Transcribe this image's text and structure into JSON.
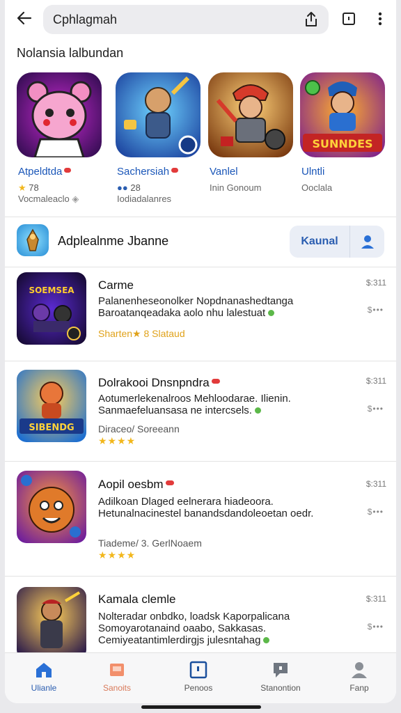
{
  "header": {
    "search_text": "Cphlagmah"
  },
  "section": {
    "title": "Nolansia lalbundan"
  },
  "featured": [
    {
      "name": "Atpeldtda",
      "rating": "78",
      "rating_icon": "star-icon",
      "developer": "Vocmaleaclo"
    },
    {
      "name": "Sachersiah",
      "rating": "28",
      "rating_icon": "dots-icon",
      "developer": "Iodiadalanres"
    },
    {
      "name": "Vanlel",
      "rating": "",
      "rating_icon": "",
      "developer": "Inin Gonoum"
    },
    {
      "name": "Ulntli",
      "rating": "",
      "rating_icon": "",
      "developer": "Ooclala"
    }
  ],
  "featured_banner_text": "SUNNDES",
  "install_row": {
    "name": "Adplealnme Jbanne",
    "button_label": "Kaunal"
  },
  "list": [
    {
      "title": "Carme",
      "description": "Palanenheseonolker Nopdnanashedtanga Baroatanqeadaka aolo nhu lalestuat",
      "meta": "Sharten★ 8 Slataud",
      "stars": "",
      "price": "$:311",
      "more": "$•••",
      "icon_text": "SOEMSEA"
    },
    {
      "title": "Dolrakooi Dnsnpndra",
      "description": "Aotumerlekenalroos Mehloodarae. Ilienin. Sanmaefeluansasa ne intercsels.",
      "meta": "Diraceo/ Soreeann",
      "stars": "★★★★",
      "price": "$:311",
      "more": "$•••",
      "icon_text": "SIBENDG"
    },
    {
      "title": "Aopil oesbm",
      "description": "Adilkoan Dlaged eelnerara hiadeoora. Hetunalnacinestel banandsdandoleoetan oedr.",
      "meta": "Tiademe/ 3. GerlNoaem",
      "stars": "★★★★",
      "price": "$:311",
      "more": "$•••",
      "icon_text": ""
    },
    {
      "title": "Kamala clemle",
      "description": "Nolteradar onbdko, loadsk Kaporpalicana Somoyarotanaind oaabo, Sakkasas. Cemiyeatantimlerdirgjs julesntahag",
      "meta": "",
      "stars": "",
      "price": "$:311",
      "more": "$•••",
      "icon_text": ""
    }
  ],
  "bottom_nav": [
    {
      "label": "Ulianle",
      "icon": "home-icon",
      "active": true
    },
    {
      "label": "Sanoits",
      "icon": "games-icon",
      "active": false
    },
    {
      "label": "Penoos",
      "icon": "apps-icon",
      "active": false
    },
    {
      "label": "Stanontion",
      "icon": "chat-icon",
      "active": false
    },
    {
      "label": "Fanp",
      "icon": "profile-icon",
      "active": false
    }
  ],
  "colors": {
    "accent": "#2a5db0",
    "link": "#1a56b8",
    "star": "#f2b71c",
    "badge": "#e23b3b",
    "home_active": "#2a70d6"
  }
}
